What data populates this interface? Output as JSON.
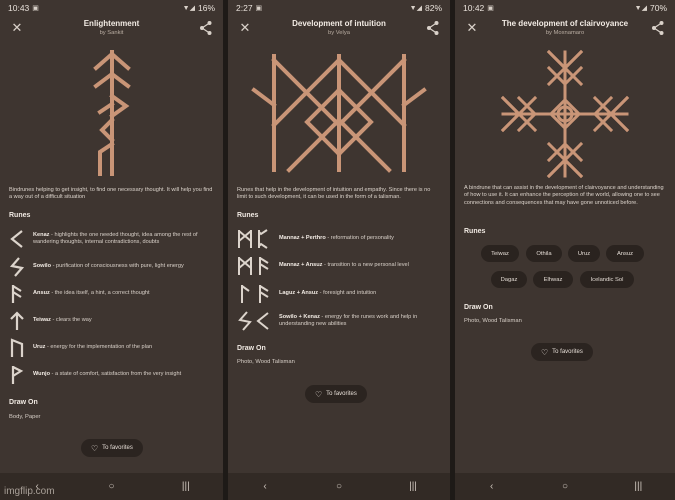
{
  "screens": [
    {
      "status": {
        "time": "10:43",
        "battery": "16%"
      },
      "title": "Enlightenment",
      "author": "by Sankit",
      "description": "Bindrunes helping to get insight, to find one necessary thought. It will help you find a way out of a difficult situation",
      "runes_heading": "Runes",
      "runes": [
        {
          "name": "Kenaz",
          "text": " - highlights the one needed thought, idea among the rest of wandering thoughts, internal contradictions, doubts",
          "glyph": "kenaz-icon"
        },
        {
          "name": "Sowilo",
          "text": " - purification of consciousness with pure, light energy",
          "glyph": "sowilo-icon"
        },
        {
          "name": "Ansuz",
          "text": " - the idea itself, a hint, a correct thought",
          "glyph": "ansuz-icon"
        },
        {
          "name": "Teiwaz",
          "text": " - clears the way",
          "glyph": "teiwaz-icon"
        },
        {
          "name": "Uruz",
          "text": " - energy for the implementation of the plan",
          "glyph": "uruz-icon"
        },
        {
          "name": "Wunjo",
          "text": " - a state of comfort, satisfaction from the very insight",
          "glyph": "wunjo-icon"
        }
      ],
      "draw_heading": "Draw On",
      "draw_on": "Body, Paper",
      "favorites_label": "To favorites"
    },
    {
      "status": {
        "time": "2:27",
        "battery": "82%"
      },
      "title": "Development of intuition",
      "author": "by Velya",
      "description": "Runes that help in the development of intuition and empathy. Since there is no limit to such development, it can be used in the form of a talisman.",
      "runes_heading": "Runes",
      "runes": [
        {
          "name": "Mannaz + Perthro",
          "text": " - reformation of personality",
          "glyph": "mannaz-perthro-icon"
        },
        {
          "name": "Mannaz + Ansuz",
          "text": " - transition to a new personal level",
          "glyph": "mannaz-ansuz-icon"
        },
        {
          "name": "Laguz + Ansuz",
          "text": " - foresight and intuition",
          "glyph": "laguz-ansuz-icon"
        },
        {
          "name": "Sowilo + Kenaz",
          "text": " - energy for the runes work and help in understanding new abilities",
          "glyph": "sowilo-kenaz-icon"
        }
      ],
      "draw_heading": "Draw On",
      "draw_on": "Photo, Wood Talisman",
      "favorites_label": "To favorites"
    },
    {
      "status": {
        "time": "10:42",
        "battery": "70%"
      },
      "title": "The development of clairvoyance",
      "author": "by Moxnamaro",
      "description": "A bindrune that can assist in the development of clairvoyance and understanding of how to use it. It can enhance the perception of the world, allowing one to see connections and consequences that may have gone unnoticed before.",
      "runes_heading": "Runes",
      "rune_chips": [
        "Teiwaz",
        "Othila",
        "Uruz",
        "Ansuz",
        "Dagaz",
        "Elhwaz",
        "Icelandic Sol"
      ],
      "draw_heading": "Draw On",
      "draw_on": "Photo, Wood Talisman",
      "favorites_label": "To favorites"
    }
  ],
  "watermark": "imgflip.com",
  "colors": {
    "background": "#3e3530",
    "rune": "#c99577",
    "chip": "#2a231f"
  }
}
